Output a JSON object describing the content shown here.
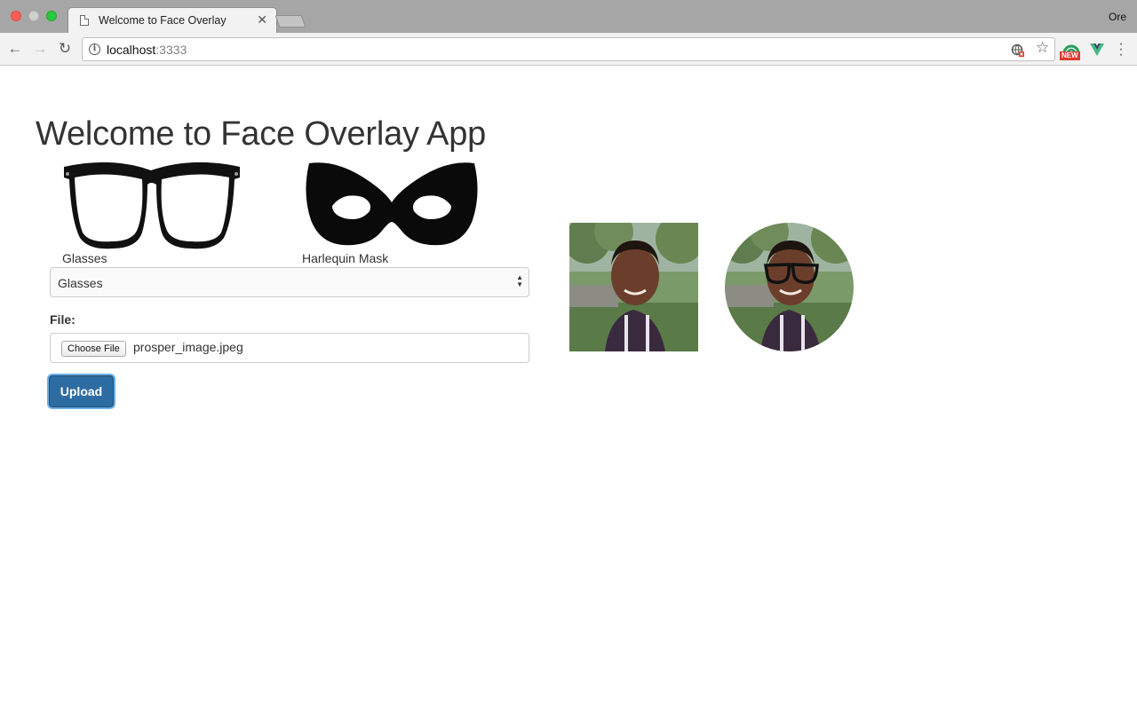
{
  "browser": {
    "tab_title": "Welcome to Face Overlay",
    "profile_name": "Ore",
    "url_host": "localhost",
    "url_port": ":3333",
    "extension_badge": "NEW"
  },
  "page": {
    "title": "Welcome to Face Overlay App",
    "overlays": [
      {
        "caption": "Glasses",
        "icon": "glasses-image"
      },
      {
        "caption": "Harlequin Mask",
        "icon": "harlequin-mask-image"
      }
    ],
    "select": {
      "value": "Glasses"
    },
    "file": {
      "label": "File:",
      "button_label": "Choose File",
      "file_name": "prosper_image.jpeg"
    },
    "upload_label": "Upload"
  },
  "colors": {
    "primary_button": "#2d6ca3",
    "text": "#333333"
  }
}
